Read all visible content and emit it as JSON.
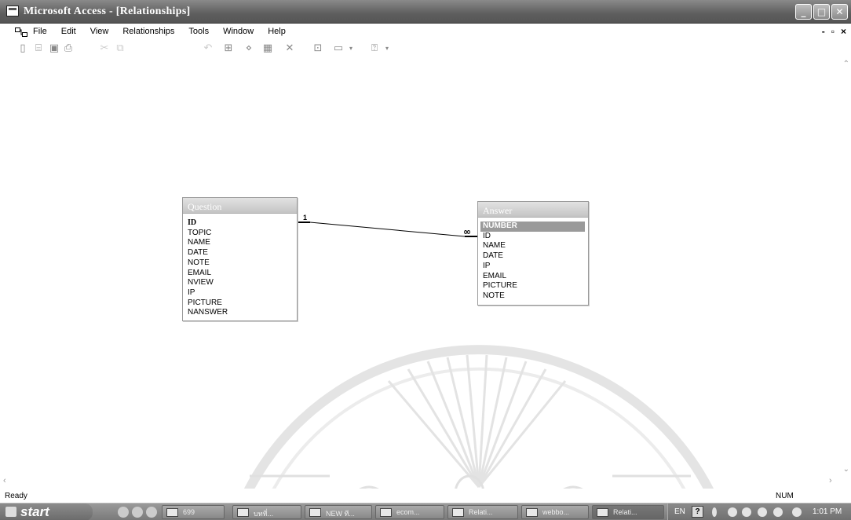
{
  "window": {
    "title": "Microsoft Access - [Relationships]",
    "buttons": {
      "minimize": "_",
      "maximize": "□",
      "close": "✕"
    }
  },
  "menu": {
    "items": [
      "File",
      "Edit",
      "View",
      "Relationships",
      "Tools",
      "Window",
      "Help"
    ],
    "mdi": {
      "minimize": "-",
      "restore": "▫",
      "close": "×"
    }
  },
  "toolbar": {
    "icons": [
      "new-icon",
      "open-icon",
      "save-icon",
      "print-icon",
      "cut-icon",
      "copy-icon",
      "paste-icon",
      "undo-icon",
      "show-table-icon",
      "show-direct-icon",
      "show-all-icon",
      "delete-icon",
      "database-window-icon",
      "new-object-icon",
      "help-icon"
    ]
  },
  "tables": {
    "question": {
      "title": "Question",
      "fields": [
        "ID",
        "TOPIC",
        "NAME",
        "DATE",
        "NOTE",
        "EMAIL",
        "NVIEW",
        "IP",
        "PICTURE",
        "NANSWER"
      ]
    },
    "answer": {
      "title": "Answer",
      "fields": [
        "NUMBER",
        "ID",
        "NAME",
        "DATE",
        "IP",
        "EMAIL",
        "PICTURE",
        "NOTE"
      ]
    }
  },
  "relationship": {
    "one_label": "1",
    "many_label": "∞"
  },
  "statusbar": {
    "left": "Ready",
    "right": "NUM"
  },
  "taskbar": {
    "start": "start",
    "tasks": [
      "699",
      "บทที่...",
      "NEW ที...",
      "ecom...",
      "Relati...",
      "webbo...",
      "Relati..."
    ],
    "language": "EN",
    "help": "?",
    "clock": "1:01 PM"
  }
}
